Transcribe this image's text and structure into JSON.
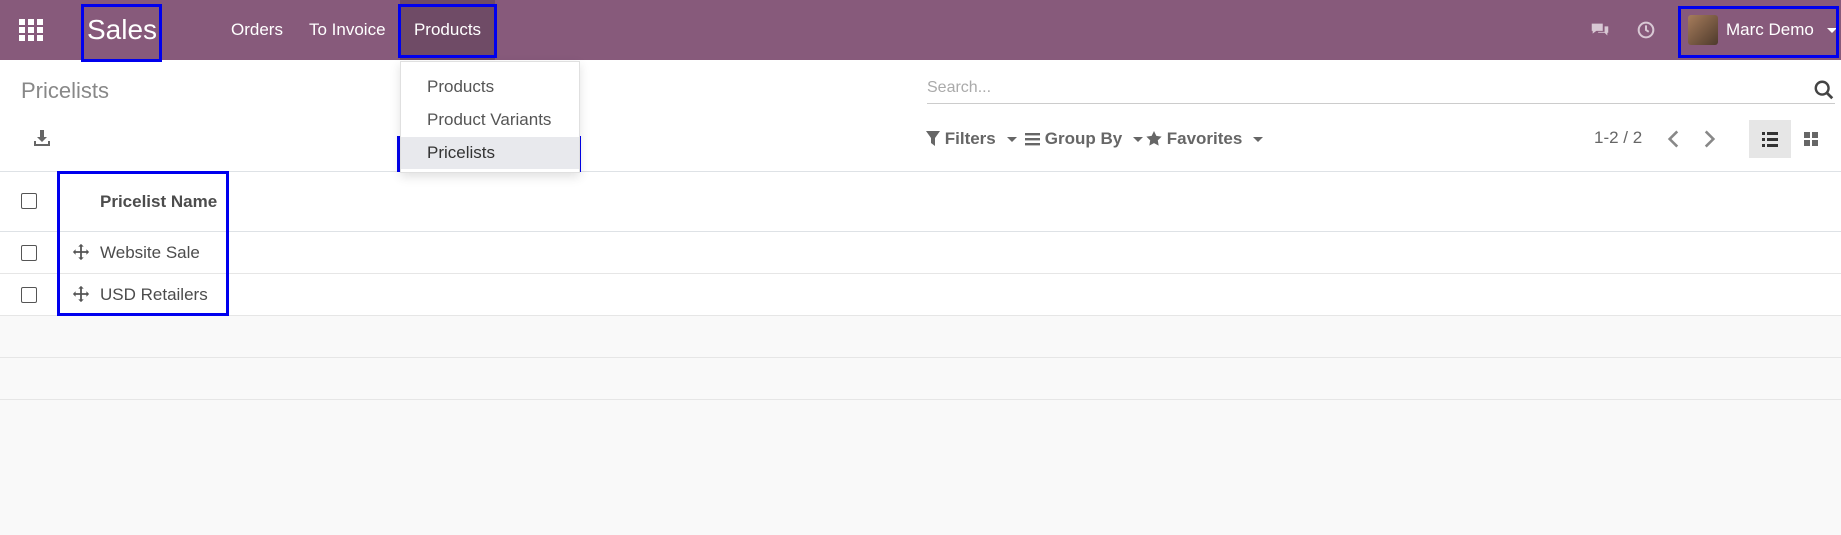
{
  "navbar": {
    "brand": "Sales",
    "menu": [
      {
        "label": "Orders"
      },
      {
        "label": "To Invoice"
      },
      {
        "label": "Products"
      }
    ],
    "user_name": "Marc Demo",
    "icons": [
      "apps-grid-icon",
      "chat-icon",
      "clock-icon",
      "avatar"
    ]
  },
  "products_menu": {
    "items": [
      {
        "label": "Products"
      },
      {
        "label": "Product Variants"
      },
      {
        "label": "Pricelists"
      }
    ]
  },
  "control_panel": {
    "title": "Pricelists",
    "search_placeholder": "Search...",
    "filters_label": "Filters",
    "group_by_label": "Group By",
    "favorites_label": "Favorites",
    "pager": "1-2 / 2"
  },
  "list": {
    "columns": [
      "Pricelist Name"
    ],
    "rows": [
      {
        "name": "Website Sale"
      },
      {
        "name": "USD Retailers"
      }
    ]
  },
  "colors": {
    "navbar": "#875a7b",
    "highlight": "#0000ee"
  }
}
